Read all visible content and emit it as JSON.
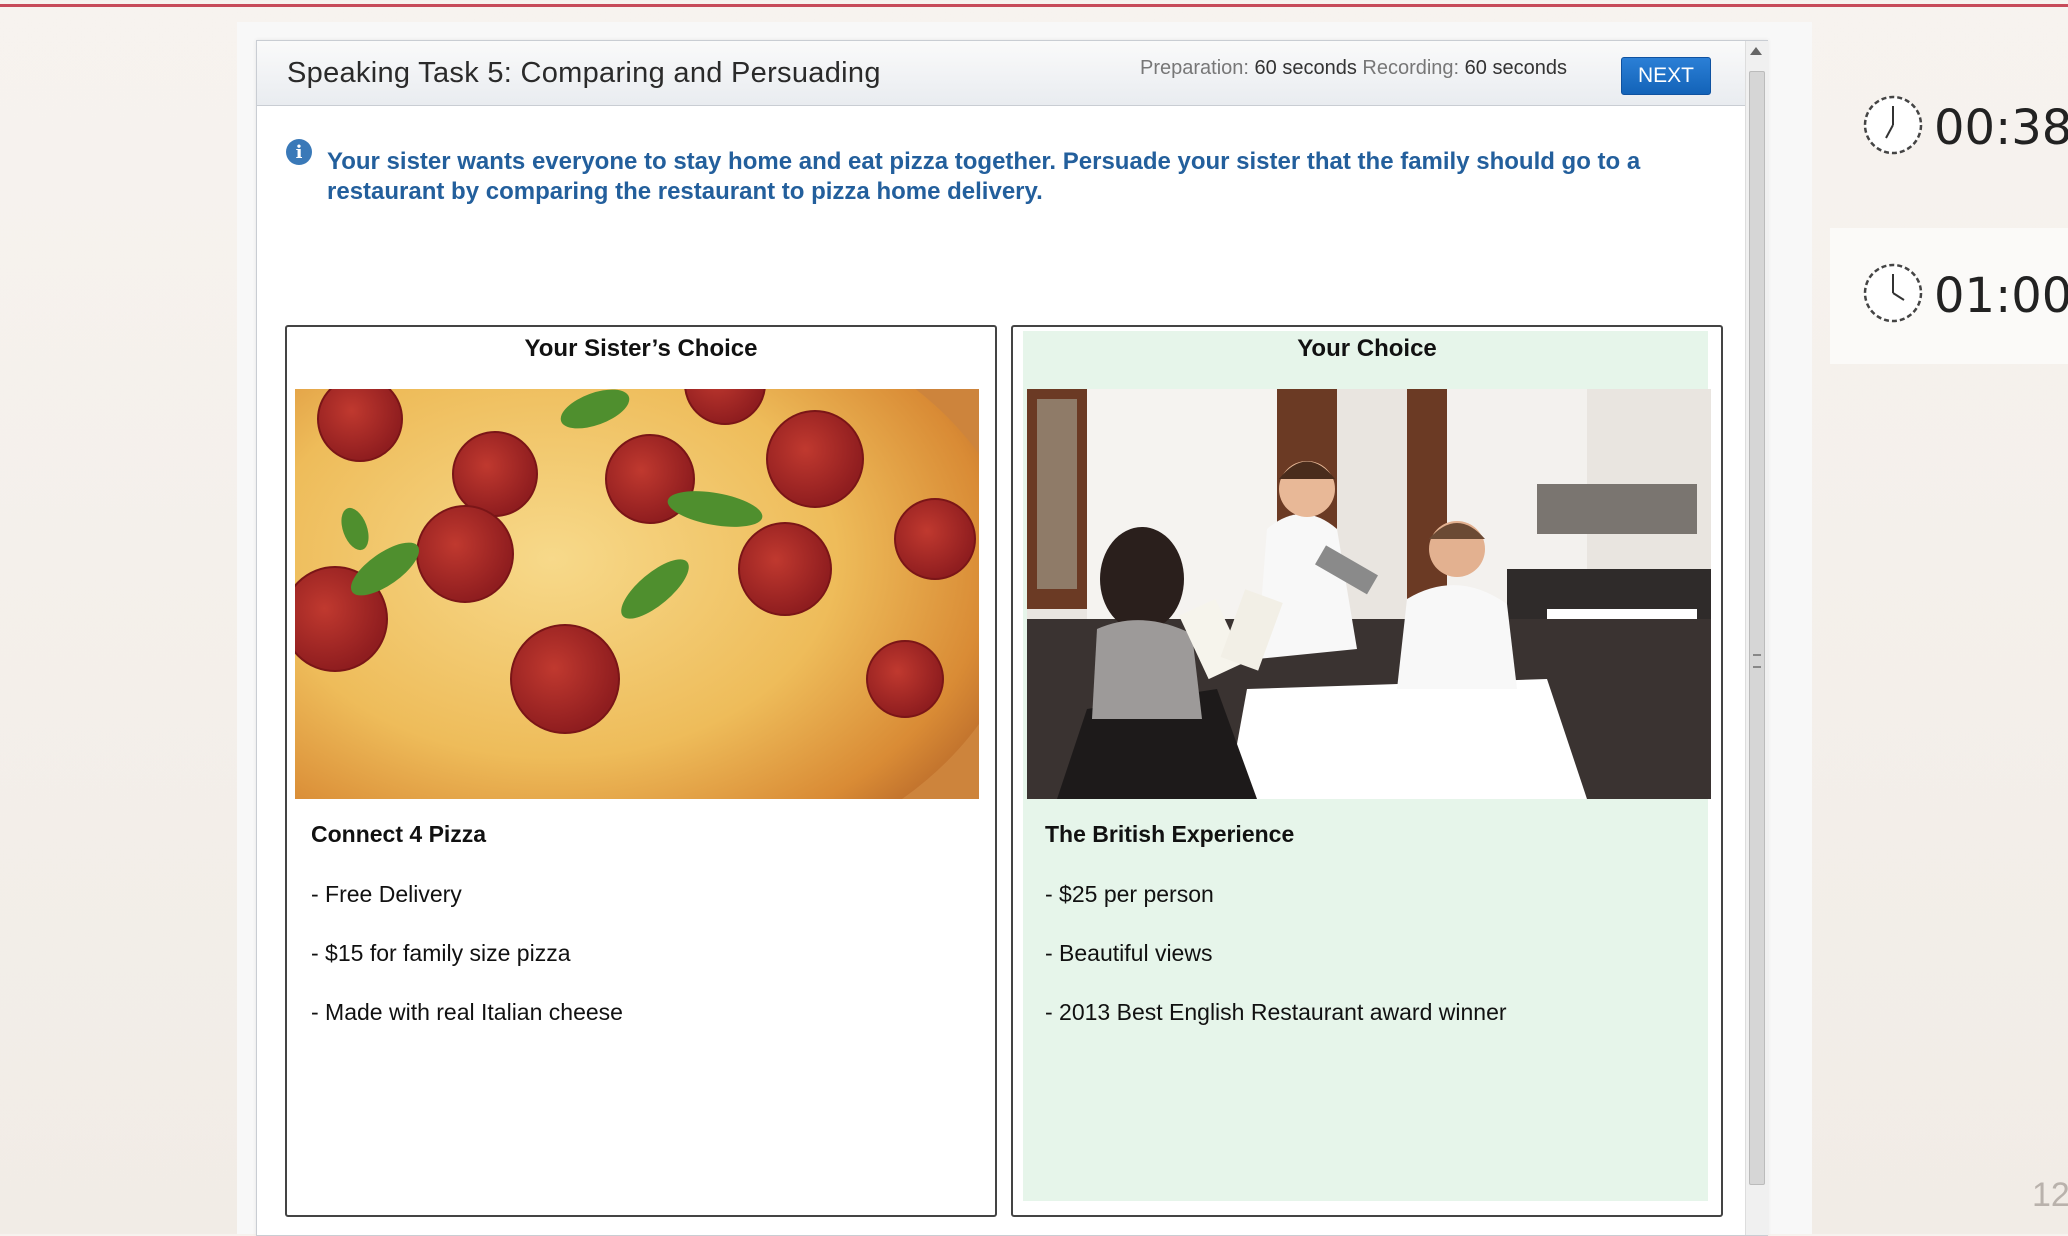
{
  "header": {
    "title": "Speaking Task 5: Comparing and Persuading",
    "prep_label": "Preparation:",
    "prep_value": "60 seconds",
    "rec_label": "Recording:",
    "rec_value": "60 seconds",
    "next_label": "NEXT"
  },
  "prompt": {
    "icon": "info-icon",
    "text": "Your sister wants everyone to stay home and eat pizza together. Persuade your sister that the family should go to a restaurant by comparing the restaurant to pizza home delivery."
  },
  "cards": [
    {
      "heading": "Your Sister’s Choice",
      "name": "Connect 4 Pizza",
      "features": [
        "- Free Delivery",
        "- $15 for family size pizza",
        "- Made with real Italian cheese"
      ]
    },
    {
      "heading": "Your Choice",
      "name": "The British Experience",
      "features": [
        "- $25 per person",
        "- Beautiful views",
        "- 2013 Best English Restaurant award winner"
      ]
    }
  ],
  "timers": {
    "preparation": "00:38",
    "recording": "01:00"
  },
  "page_number": "12",
  "colors": {
    "prompt_text": "#235f9c",
    "next_button": "#1f6fc6",
    "choice_highlight": "#e6f5ea",
    "top_line": "#c74b5a"
  }
}
